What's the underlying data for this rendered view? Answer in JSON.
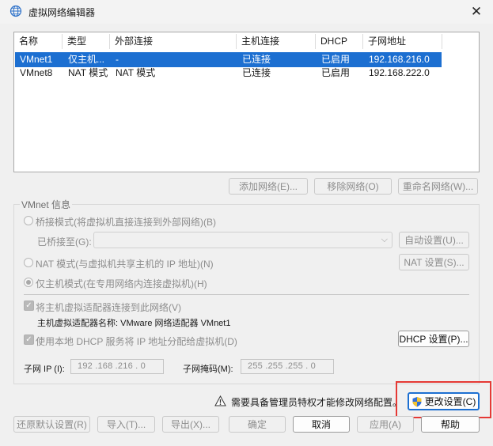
{
  "window": {
    "title": "虚拟网络编辑器",
    "close_glyph": "✕",
    "icon": "network-globe-icon"
  },
  "table": {
    "headers": [
      "名称",
      "类型",
      "外部连接",
      "主机连接",
      "DHCP",
      "子网地址"
    ],
    "rows": [
      {
        "name": "VMnet1",
        "type": "仅主机...",
        "external": "-",
        "host": "已连接",
        "dhcp": "已启用",
        "subnet": "192.168.216.0",
        "selected": true
      },
      {
        "name": "VMnet8",
        "type": "NAT 模式",
        "external": "NAT 模式",
        "host": "已连接",
        "dhcp": "已启用",
        "subnet": "192.168.222.0",
        "selected": false
      }
    ]
  },
  "list_buttons": {
    "add": "添加网络(E)...",
    "remove": "移除网络(O)",
    "rename": "重命名网络(W)..."
  },
  "vmnet_info": {
    "group_title": "VMnet 信息",
    "bridged_label": "桥接模式(将虚拟机直接连接到外部网络)(B)",
    "bridged_to_label": "已桥接至(G):",
    "bridged_to_value": "",
    "auto_settings": "自动设置(U)...",
    "nat_label": "NAT 模式(与虚拟机共享主机的 IP 地址)(N)",
    "nat_settings": "NAT 设置(S)...",
    "host_only_label": "仅主机模式(在专用网络内连接虚拟机)(H)",
    "connect_adapter_label": "将主机虚拟适配器连接到此网络(V)",
    "adapter_name_label": "主机虚拟适配器名称: VMware 网络适配器 VMnet1",
    "use_dhcp_label": "使用本地 DHCP 服务将 IP 地址分配给虚拟机(D)",
    "dhcp_settings": "DHCP 设置(P)...",
    "subnet_ip_label": "子网 IP (I):",
    "subnet_ip_value": "192 .168 .216 . 0",
    "subnet_mask_label": "子网掩码(M):",
    "subnet_mask_value": "255 .255 .255 . 0",
    "selected_mode": "host-only"
  },
  "admin": {
    "warning_text": "需要具备管理员特权才能修改网络配置。",
    "change_settings": "更改设置(C)"
  },
  "footer": {
    "restore_defaults": "还原默认设置(R)",
    "import": "导入(T)...",
    "export": "导出(X)...",
    "ok": "确定",
    "cancel": "取消",
    "apply": "应用(A)",
    "help": "帮助"
  },
  "colors": {
    "selection": "#1c6fd1",
    "highlight": "#e53935"
  }
}
